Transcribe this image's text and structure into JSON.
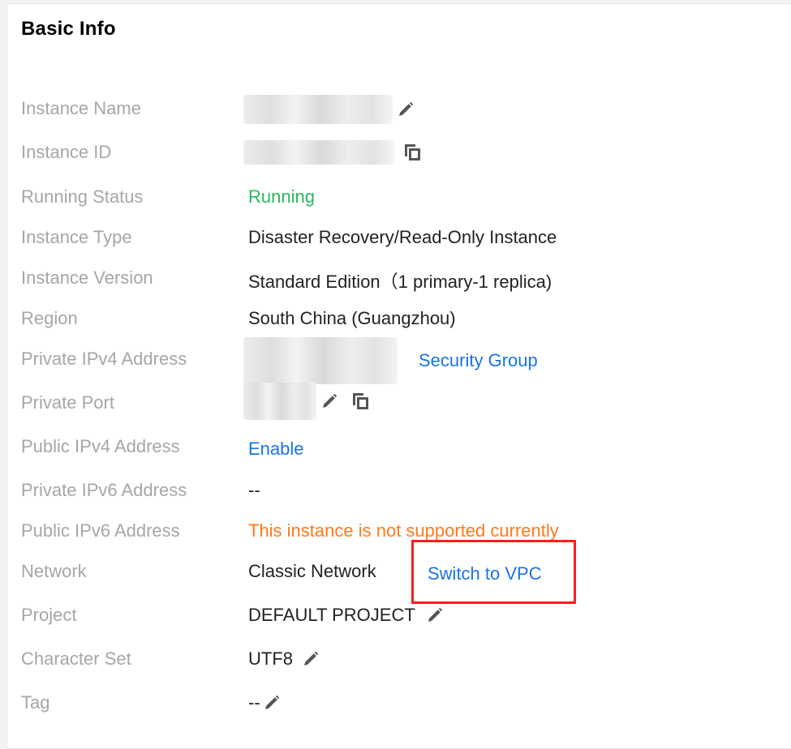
{
  "panel": {
    "title": "Basic Info"
  },
  "fields": {
    "instance_name": {
      "label": "Instance Name"
    },
    "instance_id": {
      "label": "Instance ID"
    },
    "running_status": {
      "label": "Running Status",
      "value": "Running"
    },
    "instance_type": {
      "label": "Instance Type",
      "value": "Disaster Recovery/Read-Only Instance"
    },
    "instance_version": {
      "label": "Instance Version",
      "value": "Standard Edition（1 primary-1 replica)"
    },
    "region": {
      "label": "Region",
      "value": "South China (Guangzhou)"
    },
    "private_ipv4": {
      "label": "Private IPv4 Address",
      "link": "Security Group"
    },
    "private_port": {
      "label": "Private Port"
    },
    "public_ipv4": {
      "label": "Public IPv4 Address",
      "link": "Enable"
    },
    "private_ipv6": {
      "label": "Private IPv6 Address",
      "value": "--"
    },
    "public_ipv6": {
      "label": "Public IPv6 Address",
      "value": "This instance is not supported currently"
    },
    "network": {
      "label": "Network",
      "value": "Classic Network",
      "link": "Switch to VPC"
    },
    "project": {
      "label": "Project",
      "value": "DEFAULT PROJECT"
    },
    "character_set": {
      "label": "Character Set",
      "value": "UTF8"
    },
    "tag": {
      "label": "Tag",
      "value": "--"
    }
  },
  "icons": {
    "edit": "pencil-icon",
    "copy": "copy-icon"
  },
  "colors": {
    "status_running": "#29b95c",
    "link": "#1a73e8",
    "warning": "#ff7a1a",
    "highlight": "#ff1d1d"
  }
}
